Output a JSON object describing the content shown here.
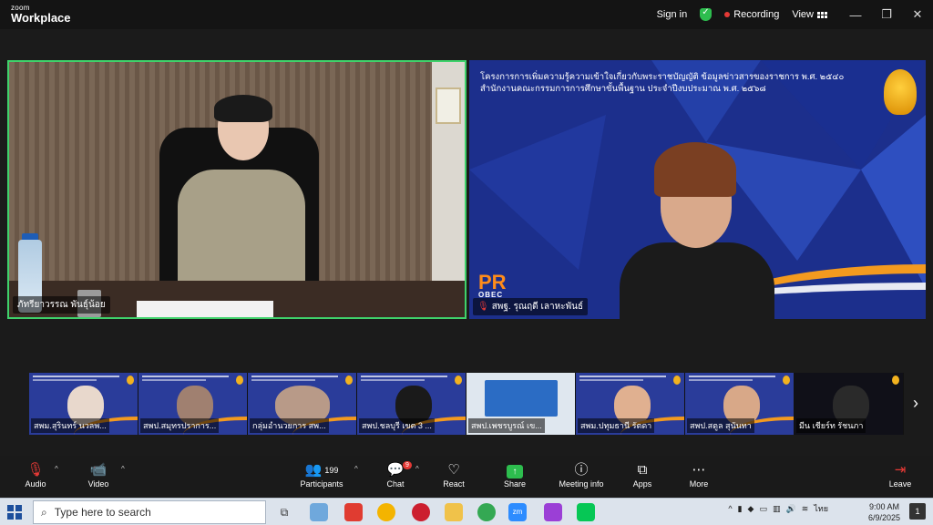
{
  "titlebar": {
    "logo_top": "zoom",
    "logo_bottom": "Workplace",
    "signin": "Sign in",
    "recording": "Recording",
    "view": "View"
  },
  "main_video": {
    "name": "ภัทรียาวรรณ พันธุ์น้อย"
  },
  "shared_screen": {
    "line1": "โครงการการเพิ่มความรู้ความเข้าใจเกี่ยวกับพระราชบัญญัติ ข้อมูลข่าวสารของราชการ พ.ศ. ๒๕๔๐",
    "line2": "สำนักงานคณะกรรมการการศึกษาขั้นพื้นฐาน ประจำปีงบประมาณ พ.ศ. ๒๕๖๘",
    "pr_logo": "PR",
    "obec": "OBEC",
    "speaker_name": "สพฐ. รุณฤดี เลาหะพันธ์"
  },
  "gallery": [
    {
      "label": "สพม.สุรินทร์ นวลพ..."
    },
    {
      "label": "สพป.สมุทรปราการ..."
    },
    {
      "label": "กลุ่มอำนวยการ สพ..."
    },
    {
      "label": "สพป.ชลบุรี เขต 3 ..."
    },
    {
      "label": "สพป.เพชรบูรณ์ เข..."
    },
    {
      "label": "สพม.ปทุมธานี รัตดา"
    },
    {
      "label": "สพป.สตูล สุนันทา"
    },
    {
      "label": "มีน เชียร์ท รัชนภา"
    }
  ],
  "toolbar": {
    "audio": "Audio",
    "video": "Video",
    "participants": "Participants",
    "participant_count": "199",
    "chat": "Chat",
    "chat_badge": "9",
    "react": "React",
    "share": "Share",
    "meeting_info": "Meeting info",
    "apps": "Apps",
    "more": "More",
    "leave": "Leave"
  },
  "taskbar": {
    "search_placeholder": "Type here to search",
    "language": "ไทย",
    "time": "9:00 AM",
    "date": "6/9/2025",
    "notification_count": "1"
  },
  "colors": {
    "active_speaker_border": "#3fd26b",
    "recording_dot": "#e53935",
    "share_green": "#2dbd4e",
    "slide_blue": "#1c2f8c",
    "slide_orange": "#f39a1f"
  }
}
